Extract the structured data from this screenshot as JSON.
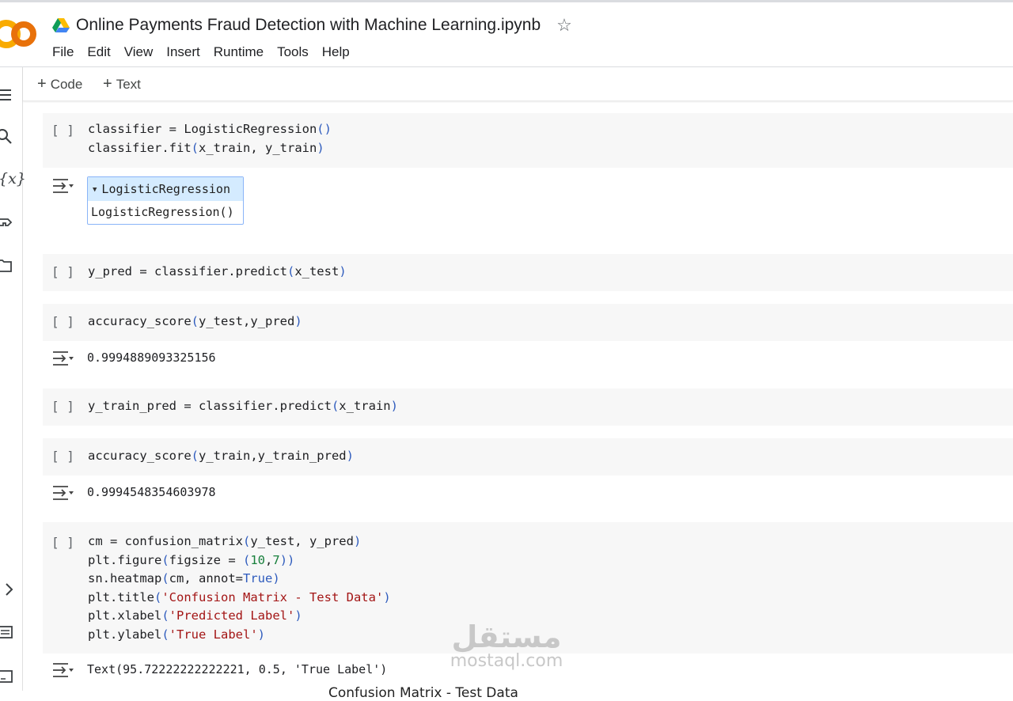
{
  "header": {
    "title": "Online Payments Fraud Detection with Machine Learning.ipynb",
    "logo_text": "CO",
    "star_icon": "star-outline-icon",
    "menu": [
      "File",
      "Edit",
      "View",
      "Insert",
      "Runtime",
      "Tools",
      "Help"
    ]
  },
  "toolbar": {
    "code_label": "Code",
    "text_label": "Text",
    "plus_symbol": "+"
  },
  "sidebar": {
    "icons": [
      "menu-icon",
      "search-icon",
      "variables-icon",
      "secrets-key-icon",
      "files-folder-icon",
      "expand-chevron-icon",
      "command-palette-icon",
      "terminal-icon"
    ],
    "variables_glyph": "{x}"
  },
  "cells": [
    {
      "bracket": "[ ]",
      "code_lines": [
        "classifier = LogisticRegression()",
        "classifier.fit(x_train, y_train)"
      ],
      "output": {
        "type": "estimator",
        "header": "LogisticRegression",
        "body": "LogisticRegression()"
      }
    },
    {
      "bracket": "[ ]",
      "code_lines": [
        "y_pred = classifier.predict(x_test)"
      ]
    },
    {
      "bracket": "[ ]",
      "code_lines": [
        "accuracy_score(y_test,y_pred)"
      ],
      "output": {
        "type": "text",
        "text": "0.9994889093325156"
      }
    },
    {
      "bracket": "[ ]",
      "code_lines": [
        "y_train_pred = classifier.predict(x_train)"
      ]
    },
    {
      "bracket": "[ ]",
      "code_lines": [
        "accuracy_score(y_train,y_train_pred)"
      ],
      "output": {
        "type": "text",
        "text": "0.9994548354603978"
      }
    },
    {
      "bracket": "[ ]",
      "code_lines": [
        "cm = confusion_matrix(y_test, y_pred)",
        "plt.figure(figsize = (10,7))",
        "sn.heatmap(cm, annot=True)",
        "plt.title('Confusion Matrix - Test Data')",
        "plt.xlabel('Predicted Label')",
        "plt.ylabel('True Label')"
      ],
      "output": {
        "type": "text",
        "text": "Text(95.72222222222221, 0.5, 'True Label')"
      },
      "plot_title_partial": "Confusion Matrix - Test Data"
    }
  ],
  "watermark": {
    "arabic": "مستقل",
    "latin": "mostaql.com"
  },
  "colors": {
    "cell_bg": "#f7f7f7",
    "estimator_header": "#d4ebff",
    "string": "#a31515",
    "number": "#19803d",
    "paren": "#2e5bbd"
  }
}
